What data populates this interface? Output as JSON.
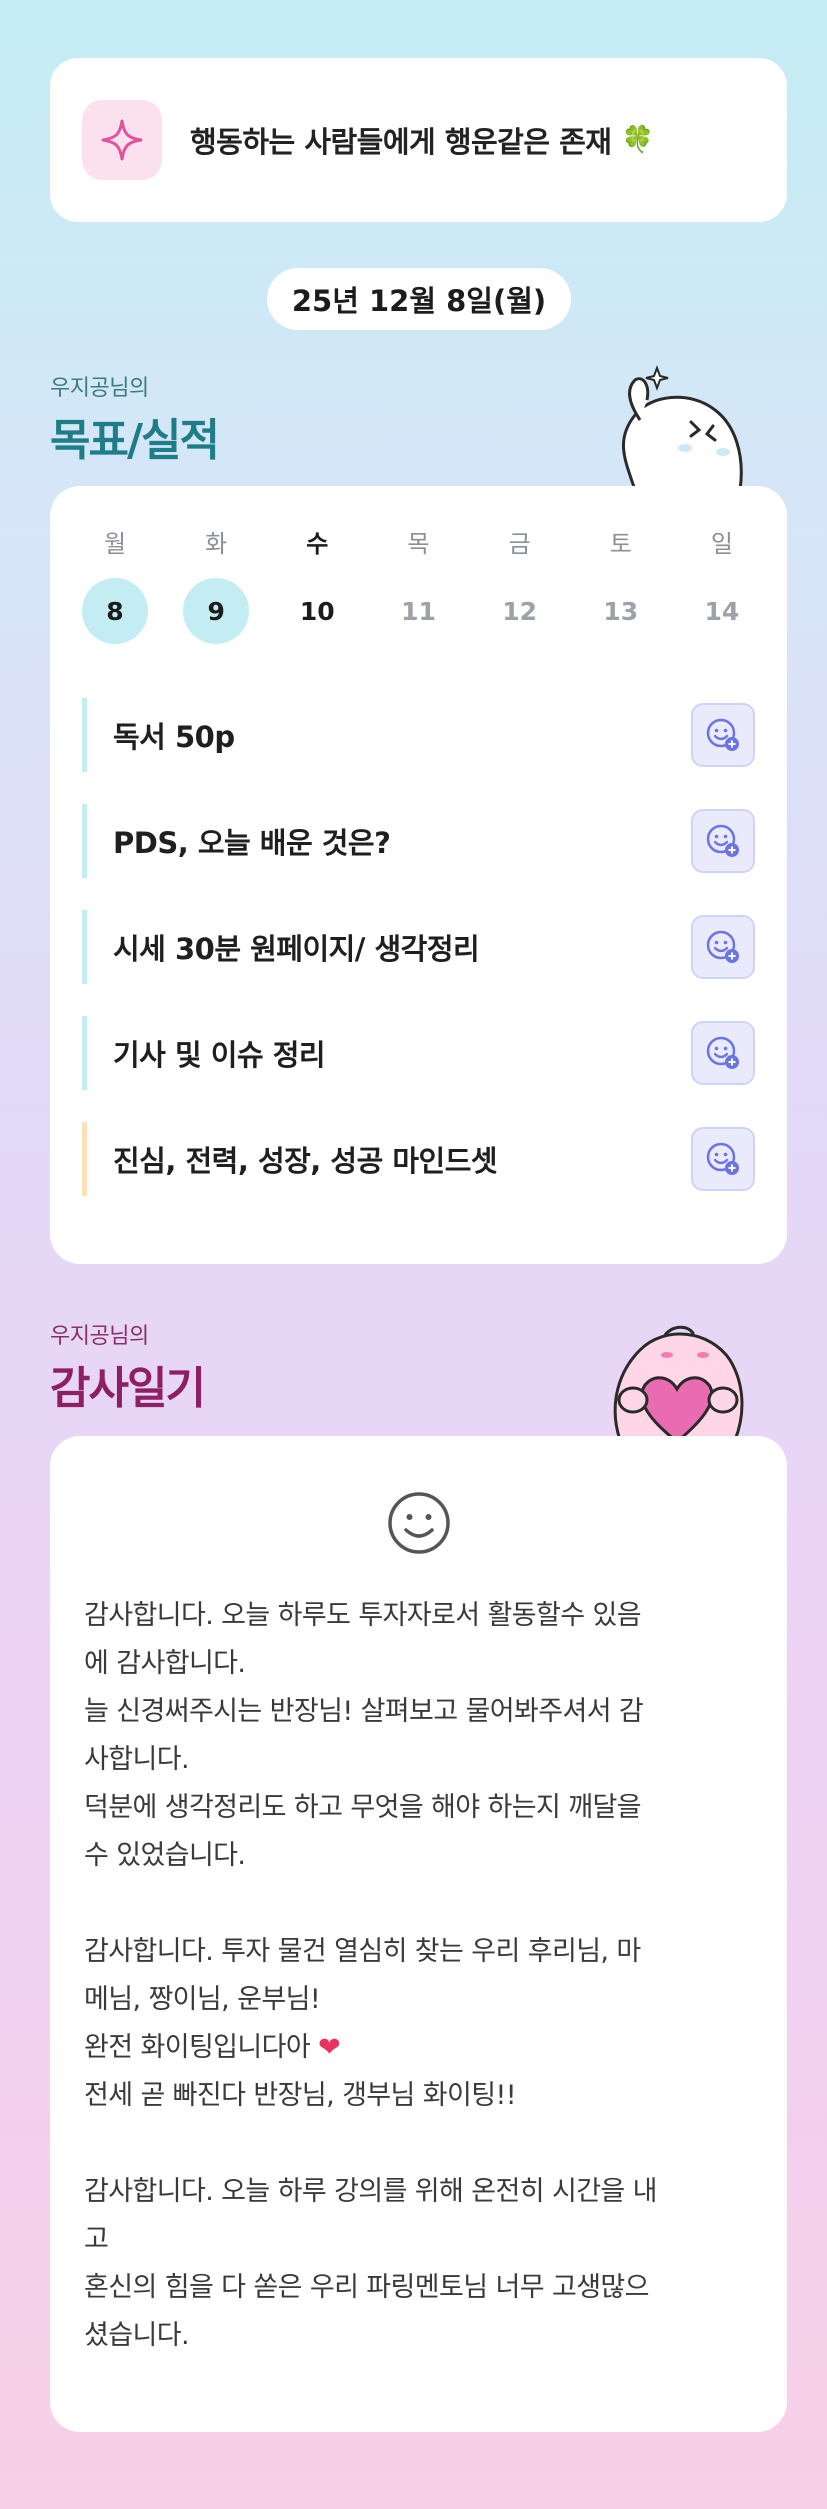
{
  "motto": {
    "text": "행동하는 사람들에게 행운같은 존재",
    "emoji": "🍀"
  },
  "date": "25년 12월 8일(월)",
  "goals_section": {
    "subtitle": "우지공님의",
    "title": "목표/실적"
  },
  "week": [
    {
      "name": "월",
      "num": "8",
      "state": "done"
    },
    {
      "name": "화",
      "num": "9",
      "state": "done"
    },
    {
      "name": "수",
      "num": "10",
      "state": "today"
    },
    {
      "name": "목",
      "num": "11",
      "state": "future"
    },
    {
      "name": "금",
      "num": "12",
      "state": "future"
    },
    {
      "name": "토",
      "num": "13",
      "state": "future"
    },
    {
      "name": "일",
      "num": "14",
      "state": "future"
    }
  ],
  "goals": [
    {
      "text": "독서 50p"
    },
    {
      "text": "PDS, 오늘 배운 것은?"
    },
    {
      "text": "시세 30분 원페이지/ 생각정리"
    },
    {
      "text": "기사 및 이슈 정리"
    },
    {
      "text": "진심, 전력, 성장, 성공 마인드셋"
    }
  ],
  "thanks_section": {
    "subtitle": "우지공님의",
    "title": "감사일기"
  },
  "diary": {
    "text_before_heart": "감사합니다. 오늘 하루도 투자자로서 활동할수 있음\n에 감사합니다.\n늘 신경써주시는 반장님! 살펴보고 물어봐주셔서 감\n사합니다.\n덕분에 생각정리도 하고 무엇을 해야 하는지 깨달을\n수 있었습니다.\n\n감사합니다. 투자 물건 열심히 찾는 우리 후리님, 마\n메님, 짱이님, 운부님!\n완전 화이팅입니다아 ",
    "heart": "❤",
    "text_after_heart": "\n전세 곧 빠진다 반장님, 갱부님 화이팅!!\n\n감사합니다. 오늘 하루 강의를 위해 온전히 시간을 내\n고\n혼신의 힘을 다 쏟은 우리 파링멘토님 너무 고생많으\n셨습니다."
  },
  "colors": {
    "goals_title": "#1f7d87",
    "thanks_title": "#8e1f64",
    "done_day_bg": "#c4ecf3",
    "heart": "#e8335f"
  }
}
